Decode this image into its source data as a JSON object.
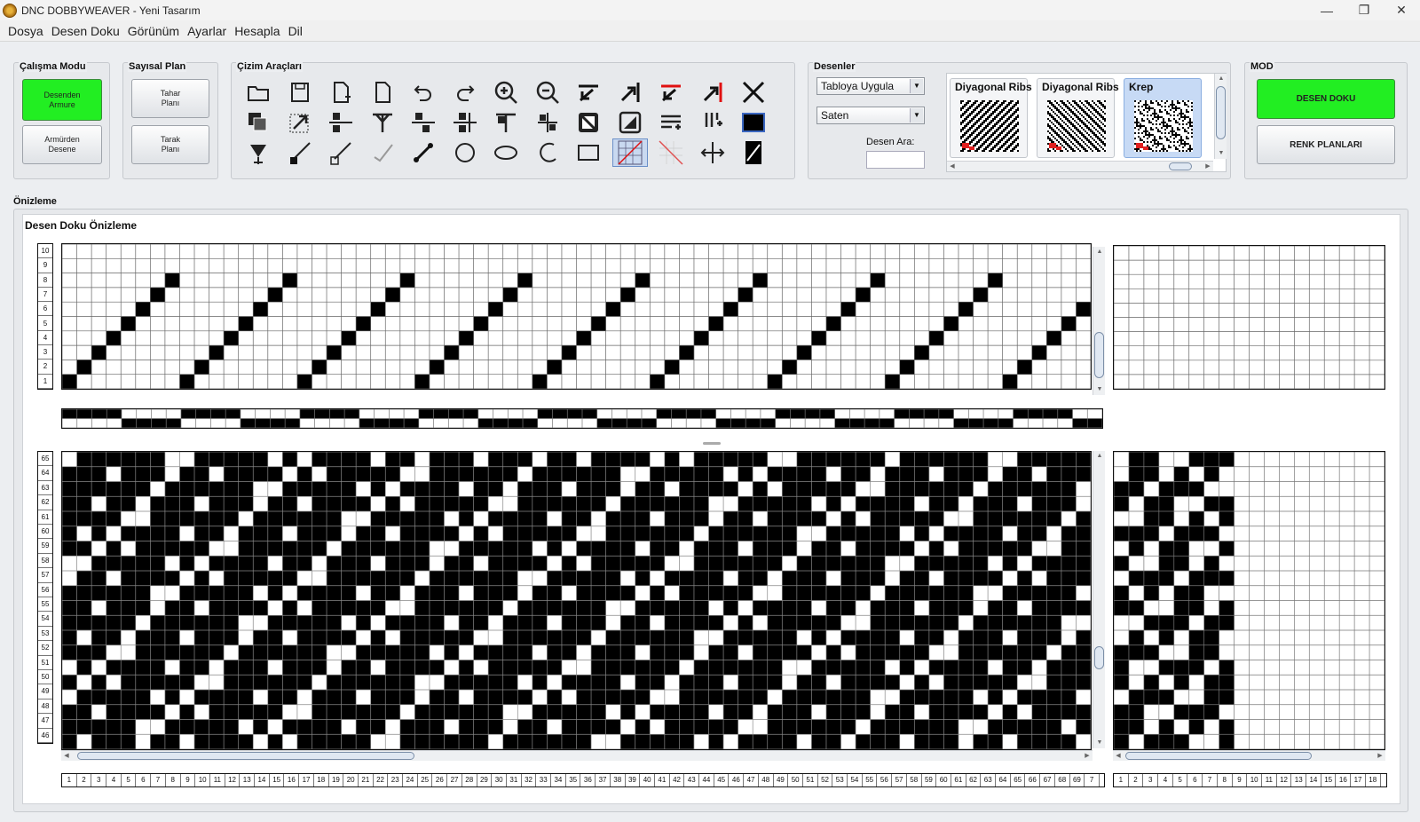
{
  "window": {
    "title": "DNC DOBBYWEAVER - Yeni Tasarım",
    "minimize": "—",
    "maximize": "❐",
    "close": "✕"
  },
  "menu": [
    "Dosya",
    "Desen Doku",
    "Görünüm",
    "Ayarlar",
    "Hesapla",
    "Dil"
  ],
  "calisma_modu": {
    "label": "Çalışma Modu",
    "btn1": "Desenden\nArmure",
    "btn2": "Armürden\nDesene"
  },
  "sayisal_plan": {
    "label": "Sayısal Plan",
    "btn1": "Tahar\nPlanı",
    "btn2": "Tarak\nPlanı"
  },
  "cizim": {
    "label": "Çizim Araçları",
    "tools": [
      "folder-open",
      "save",
      "new-document",
      "document",
      "undo",
      "redo",
      "zoom-in",
      "zoom-out",
      "shift-up-left",
      "shift-right-up",
      "shift-red-left",
      "shift-red-right",
      "clear-x",
      "copy",
      "select-move",
      "flip-left",
      "flip-down",
      "flip-right",
      "flip-mid",
      "flip-top",
      "flip-center",
      "invert-fill",
      "invert-half",
      "insert-row",
      "insert-col",
      "fill-black",
      "fill-bucket",
      "draw-line-filled",
      "draw-line-empty",
      "draw-curve",
      "draw-link",
      "draw-circle",
      "draw-ellipse",
      "draw-arc",
      "draw-rect",
      "grid-diagonal",
      "grid-erase",
      "stretch-horizontal",
      "stripe-pattern"
    ]
  },
  "desenler": {
    "label": "Desenler",
    "select1": "Tabloya Uygula",
    "select2": "Saten",
    "search_label": "Desen Ara:",
    "search_value": ""
  },
  "thumbs": [
    {
      "name": "Diyagonal Ribs"
    },
    {
      "name": "Diyagonal Ribs"
    },
    {
      "name": "Krep"
    }
  ],
  "mod": {
    "label": "MOD",
    "btn1": "DESEN DOKU",
    "btn2": "RENK PLANLARI"
  },
  "colors": {
    "accent_green": "#22ee22"
  },
  "preview": {
    "outer_label": "Önizleme",
    "inner_label": "Desen Doku Önizleme"
  },
  "top_rows": [
    "10",
    "9",
    "8",
    "7",
    "6",
    "5",
    "4",
    "3",
    "2",
    "1"
  ],
  "bottom_rows": [
    "65",
    "64",
    "63",
    "62",
    "61",
    "60",
    "59",
    "58",
    "57",
    "56",
    "55",
    "54",
    "53",
    "52",
    "51",
    "50",
    "49",
    "48",
    "47",
    "46"
  ],
  "col_numbers": [
    "1",
    "2",
    "3",
    "4",
    "5",
    "6",
    "7",
    "8",
    "9",
    "10",
    "11",
    "12",
    "13",
    "14",
    "15",
    "16",
    "17",
    "18",
    "19",
    "20",
    "21",
    "22",
    "23",
    "24",
    "25",
    "26",
    "27",
    "28",
    "29",
    "30",
    "31",
    "32",
    "33",
    "34",
    "35",
    "36",
    "37",
    "38",
    "39",
    "40",
    "41",
    "42",
    "43",
    "44",
    "45",
    "46",
    "47",
    "48",
    "49",
    "50",
    "51",
    "52",
    "53",
    "54",
    "55",
    "56",
    "57",
    "58",
    "59",
    "60",
    "61",
    "62",
    "63",
    "64",
    "65",
    "66",
    "67",
    "68",
    "69",
    "7"
  ],
  "right_col_numbers": [
    "1",
    "2",
    "3",
    "4",
    "5",
    "6",
    "7",
    "8",
    "9",
    "10",
    "11",
    "12",
    "13",
    "14",
    "15",
    "16",
    "17",
    "18"
  ]
}
